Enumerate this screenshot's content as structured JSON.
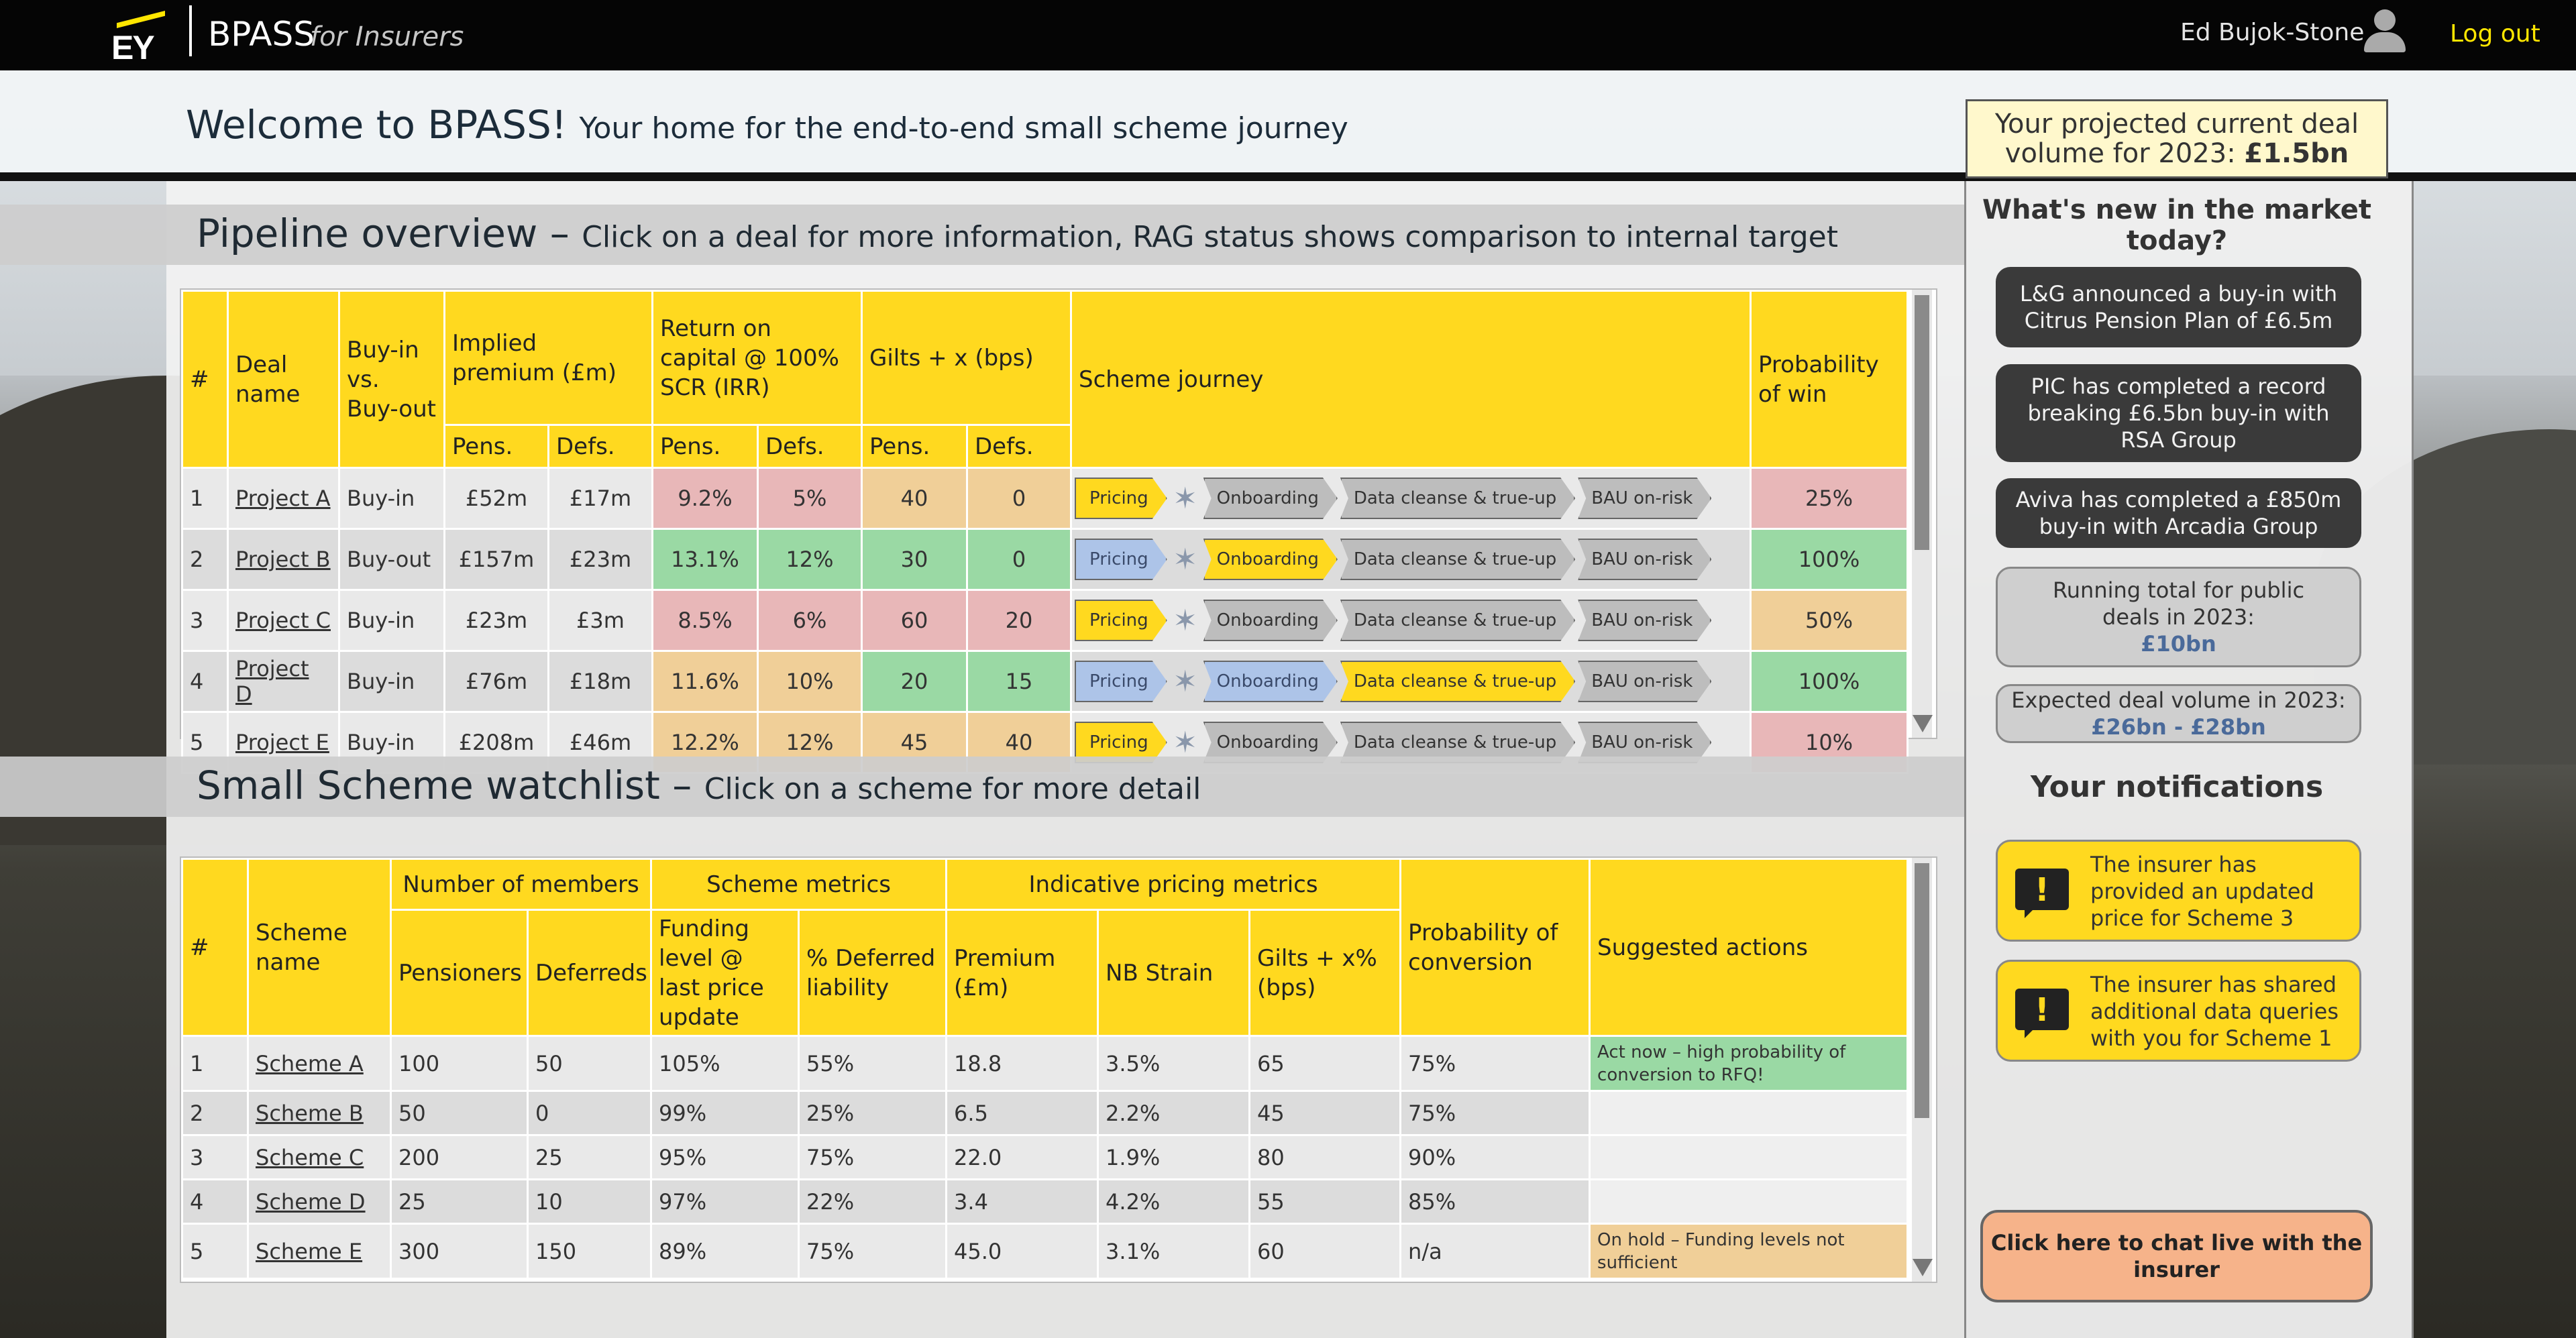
{
  "header": {
    "brand": "EY",
    "app_name": "BPASS",
    "app_sub": "for Insurers",
    "user": "Ed Bujok-Stone",
    "logout": "Log out"
  },
  "welcome": {
    "title": "Welcome to BPASS!",
    "subtitle": "Your home for the end-to-end small scheme journey"
  },
  "deal_volume": {
    "line1": "Your projected current deal",
    "line2": "volume for 2023:",
    "value": "£1.5bn"
  },
  "pipeline": {
    "title": "Pipeline overview",
    "subtitle": "Click on a deal for more information, RAG status shows comparison to internal target",
    "headers": {
      "num": "#",
      "deal": "Deal name",
      "buy": "Buy-in vs. Buy-out",
      "premium": "Implied premium (£m)",
      "roc": "Return on capital @ 100% SCR (IRR)",
      "gilts": "Gilts + x (bps)",
      "journey": "Scheme journey",
      "prob": "Probability of win",
      "pens": "Pens.",
      "defs": "Defs."
    },
    "rows": [
      {
        "num": "1",
        "name": "Project A",
        "type": "Buy-in",
        "prem_p": "£52m",
        "prem_d": "£17m",
        "roc_p": "9.2%",
        "roc_d": "5%",
        "gilt_p": "40",
        "gilt_d": "0",
        "prob": "25%",
        "rag_roc_p": "red",
        "rag_roc_d": "red",
        "rag_gilt_p": "amber",
        "rag_gilt_d": "amber",
        "rag_prob": "red",
        "stage": 0
      },
      {
        "num": "2",
        "name": "Project B",
        "type": "Buy-out",
        "prem_p": "£157m",
        "prem_d": "£23m",
        "roc_p": "13.1%",
        "roc_d": "12%",
        "gilt_p": "30",
        "gilt_d": "0",
        "prob": "100%",
        "rag_roc_p": "green",
        "rag_roc_d": "green",
        "rag_gilt_p": "green",
        "rag_gilt_d": "green",
        "rag_prob": "green",
        "stage": 1
      },
      {
        "num": "3",
        "name": "Project C",
        "type": "Buy-in",
        "prem_p": "£23m",
        "prem_d": "£3m",
        "roc_p": "8.5%",
        "roc_d": "6%",
        "gilt_p": "60",
        "gilt_d": "20",
        "prob": "50%",
        "rag_roc_p": "red",
        "rag_roc_d": "red",
        "rag_gilt_p": "red",
        "rag_gilt_d": "red",
        "rag_prob": "amber",
        "stage": 0
      },
      {
        "num": "4",
        "name": "Project D",
        "type": "Buy-in",
        "prem_p": "£76m",
        "prem_d": "£18m",
        "roc_p": "11.6%",
        "roc_d": "10%",
        "gilt_p": "20",
        "gilt_d": "15",
        "prob": "100%",
        "rag_roc_p": "amber",
        "rag_roc_d": "amber",
        "rag_gilt_p": "green",
        "rag_gilt_d": "green",
        "rag_prob": "green",
        "stage": 2
      },
      {
        "num": "5",
        "name": "Project E",
        "type": "Buy-in",
        "prem_p": "£208m",
        "prem_d": "£46m",
        "roc_p": "12.2%",
        "roc_d": "12%",
        "gilt_p": "45",
        "gilt_d": "40",
        "prob": "10%",
        "rag_roc_p": "amber",
        "rag_roc_d": "amber",
        "rag_gilt_p": "amber",
        "rag_gilt_d": "amber",
        "rag_prob": "red",
        "stage": 0
      }
    ],
    "steps": [
      "Pricing",
      "Onboarding",
      "Data cleanse & true-up",
      "BAU on-risk"
    ]
  },
  "watchlist": {
    "title": "Small Scheme watchlist",
    "subtitle": "Click on a scheme for more detail",
    "headers": {
      "num": "#",
      "scheme": "Scheme name",
      "members": "Number of members",
      "metrics": "Scheme metrics",
      "pricing": "Indicative pricing metrics",
      "prob": "Probability of conversion",
      "actions": "Suggested actions",
      "pensioners": "Pensioners",
      "deferreds": "Deferreds",
      "funding": "Funding level @ last price update",
      "deferred_liab": "% Deferred liability",
      "premium": "Premium (£m)",
      "nb": "NB Strain",
      "gilts": "Gilts + x% (bps)"
    },
    "rows": [
      {
        "num": "1",
        "name": "Scheme A",
        "pens": "100",
        "defs": "50",
        "funding": "105%",
        "defl": "55%",
        "prem": "18.8",
        "nb": "3.5%",
        "gilts": "65",
        "prob": "75%",
        "action": "Act now – high probability of conversion to RFQ!",
        "action_style": "green"
      },
      {
        "num": "2",
        "name": "Scheme B",
        "pens": "50",
        "defs": "0",
        "funding": "99%",
        "defl": "25%",
        "prem": "6.5",
        "nb": "2.2%",
        "gilts": "45",
        "prob": "75%",
        "action": "",
        "action_style": "none"
      },
      {
        "num": "3",
        "name": "Scheme C",
        "pens": "200",
        "defs": "25",
        "funding": "95%",
        "defl": "75%",
        "prem": "22.0",
        "nb": "1.9%",
        "gilts": "80",
        "prob": "90%",
        "action": "",
        "action_style": "none"
      },
      {
        "num": "4",
        "name": "Scheme D",
        "pens": "25",
        "defs": "10",
        "funding": "97%",
        "defl": "22%",
        "prem": "3.4",
        "nb": "4.2%",
        "gilts": "55",
        "prob": "85%",
        "action": "",
        "action_style": "none"
      },
      {
        "num": "5",
        "name": "Scheme E",
        "pens": "300",
        "defs": "150",
        "funding": "89%",
        "defl": "75%",
        "prem": "45.0",
        "nb": "3.1%",
        "gilts": "60",
        "prob": "n/a",
        "action": "On hold – Funding levels not sufficient",
        "action_style": "amber"
      }
    ]
  },
  "market": {
    "title": "What's new in the market today?",
    "news": [
      "L&G announced a buy-in with Citrus Pension Plan of £6.5m",
      "PIC has completed a record breaking £6.5bn buy-in with RSA Group",
      "Aviva has completed a £850m buy-in with Arcadia Group"
    ],
    "running_total_label": "Running total for public deals in 2023:",
    "running_total_value": "£10bn",
    "expected_label": "Expected deal volume in 2023:",
    "expected_value": "£26bn - £28bn"
  },
  "notifications": {
    "title": "Your notifications",
    "items": [
      "The insurer has provided an updated price for Scheme 3",
      "The insurer has shared additional data queries with you for Scheme 1"
    ]
  },
  "chat": {
    "label": "Click here to chat live with the insurer"
  }
}
